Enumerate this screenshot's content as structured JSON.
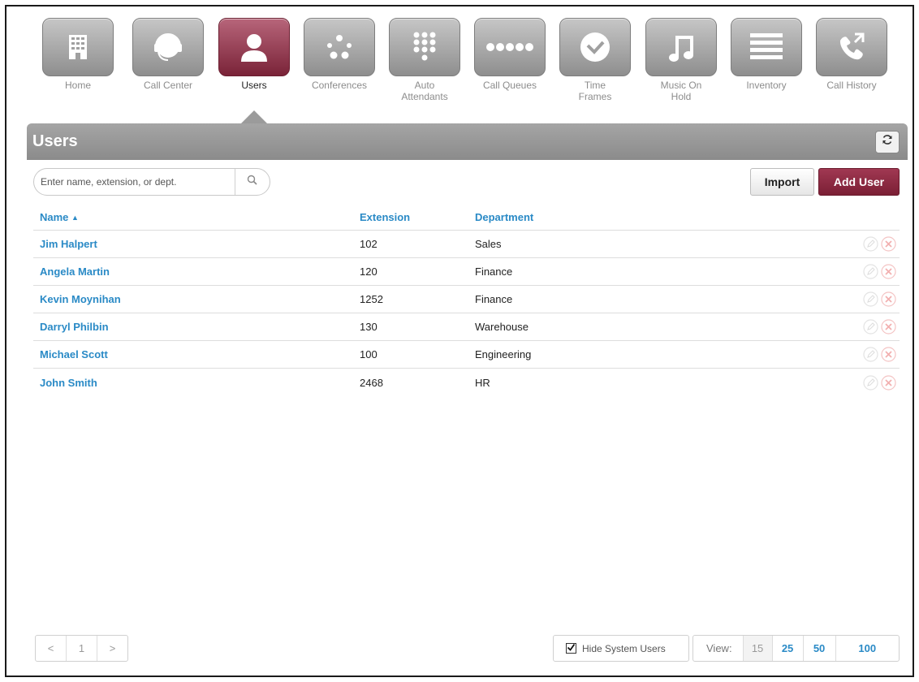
{
  "nav": {
    "items": [
      {
        "label": "Home",
        "icon": "building-icon"
      },
      {
        "label": "Call Center",
        "icon": "headset-icon"
      },
      {
        "label": "Users",
        "icon": "user-icon",
        "active": true
      },
      {
        "label": "Conferences",
        "icon": "dots-cluster-icon"
      },
      {
        "label": "Auto\nAttendants",
        "icon": "keypad-icon"
      },
      {
        "label": "Call Queues",
        "icon": "dots-row-icon"
      },
      {
        "label": "Time\nFrames",
        "icon": "clock-icon"
      },
      {
        "label": "Music On\nHold",
        "icon": "music-note-icon"
      },
      {
        "label": "Inventory",
        "icon": "list-icon"
      },
      {
        "label": "Call History",
        "icon": "phone-arrows-icon"
      }
    ]
  },
  "section": {
    "title": "Users"
  },
  "search": {
    "placeholder": "Enter name, extension, or dept.",
    "value": ""
  },
  "toolbar": {
    "import_label": "Import",
    "add_label": "Add User"
  },
  "table": {
    "headers": {
      "name": "Name",
      "name_sort": "▲",
      "extension": "Extension",
      "department": "Department"
    },
    "rows": [
      {
        "name": "Jim Halpert",
        "extension": "102",
        "department": "Sales"
      },
      {
        "name": "Angela Martin",
        "extension": "120",
        "department": "Finance"
      },
      {
        "name": "Kevin Moynihan",
        "extension": "1252",
        "department": "Finance"
      },
      {
        "name": "Darryl Philbin",
        "extension": "130",
        "department": "Warehouse"
      },
      {
        "name": "Michael Scott",
        "extension": "100",
        "department": "Engineering"
      },
      {
        "name": "John Smith",
        "extension": "2468",
        "department": "HR"
      }
    ]
  },
  "pager": {
    "prev": "<",
    "page": "1",
    "next": ">"
  },
  "footer": {
    "hide_system_label": "Hide System Users",
    "hide_system_checked": true,
    "view_label": "View:",
    "view_options": [
      "15",
      "25",
      "50",
      "100"
    ],
    "view_current": "15"
  },
  "colors": {
    "accent": "#8c2a42",
    "link": "#2a8ac6",
    "nav_tile": "#a8a8a8",
    "section_bar": "#999999"
  }
}
